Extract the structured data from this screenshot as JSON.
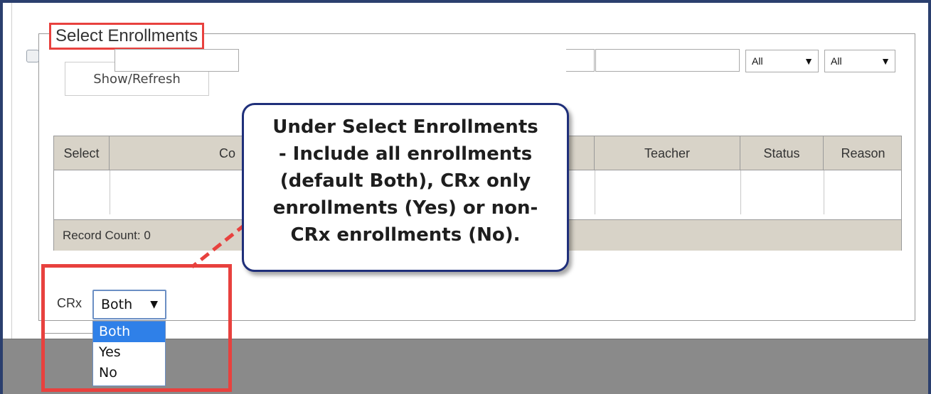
{
  "fieldset": {
    "legend": "Select Enrollments"
  },
  "toolbar": {
    "show_refresh_label": "Show/Refresh"
  },
  "grid": {
    "columns": [
      "Select",
      "Co",
      "Teacher",
      "Status",
      "Reason"
    ],
    "filters": {
      "status_value": "All",
      "reason_value": "All"
    },
    "record_count": "Record Count: 0"
  },
  "crx": {
    "label": "CRx",
    "selected": "Both",
    "options": [
      "Both",
      "Yes",
      "No"
    ]
  },
  "callout": {
    "lines": [
      "Under Select Enrollments",
      "-  Include all enrollments",
      "(default Both), CRx only",
      "enrollments (Yes) or non-",
      "CRx enrollments (No)."
    ]
  },
  "colors": {
    "highlight": "#e8413e",
    "callout_border": "#1f2f7a",
    "selected_option": "#2f80e8",
    "grid_header": "#d8d3c8"
  },
  "icons": {
    "dropdown": "triangle-down-icon"
  }
}
